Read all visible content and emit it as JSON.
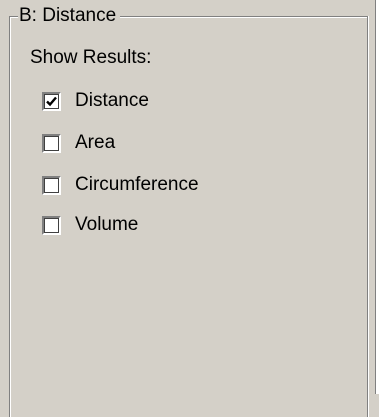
{
  "groupbox": {
    "title": "B: Distance"
  },
  "show_results_label": "Show Results:",
  "options": [
    {
      "label": "Distance",
      "checked": true
    },
    {
      "label": "Area",
      "checked": false
    },
    {
      "label": "Circumference",
      "checked": false
    },
    {
      "label": "Volume",
      "checked": false
    }
  ]
}
